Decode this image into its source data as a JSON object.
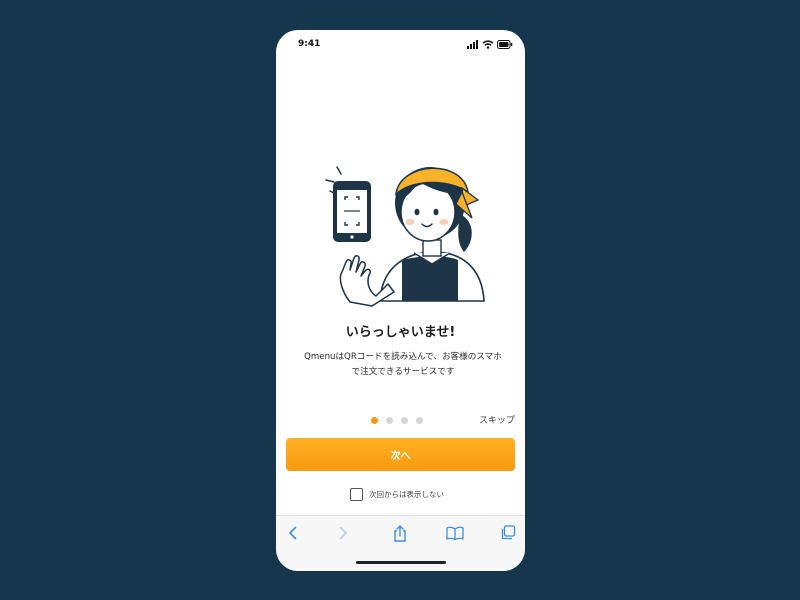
{
  "status_bar": {
    "time": "9:41"
  },
  "onboarding": {
    "title": "いらっしゃいませ!",
    "description_line1": "QmenuはQRコードを読み込んで、お客様のスマホ",
    "description_line2": "で注文できるサービスです",
    "page_current": 1,
    "page_total": 4,
    "skip_label": "スキップ",
    "next_label": "次へ",
    "dont_show_label": "次回からは表示しない",
    "dont_show_checked": false
  },
  "browser_toolbar": {
    "icons": [
      "back-icon",
      "forward-icon",
      "share-icon",
      "bookmarks-icon",
      "tabs-icon"
    ]
  },
  "colors": {
    "background": "#15364d",
    "accent": "#f7a01a",
    "navy": "#1d3547",
    "toolbar_icon": "#3b8fe0"
  }
}
